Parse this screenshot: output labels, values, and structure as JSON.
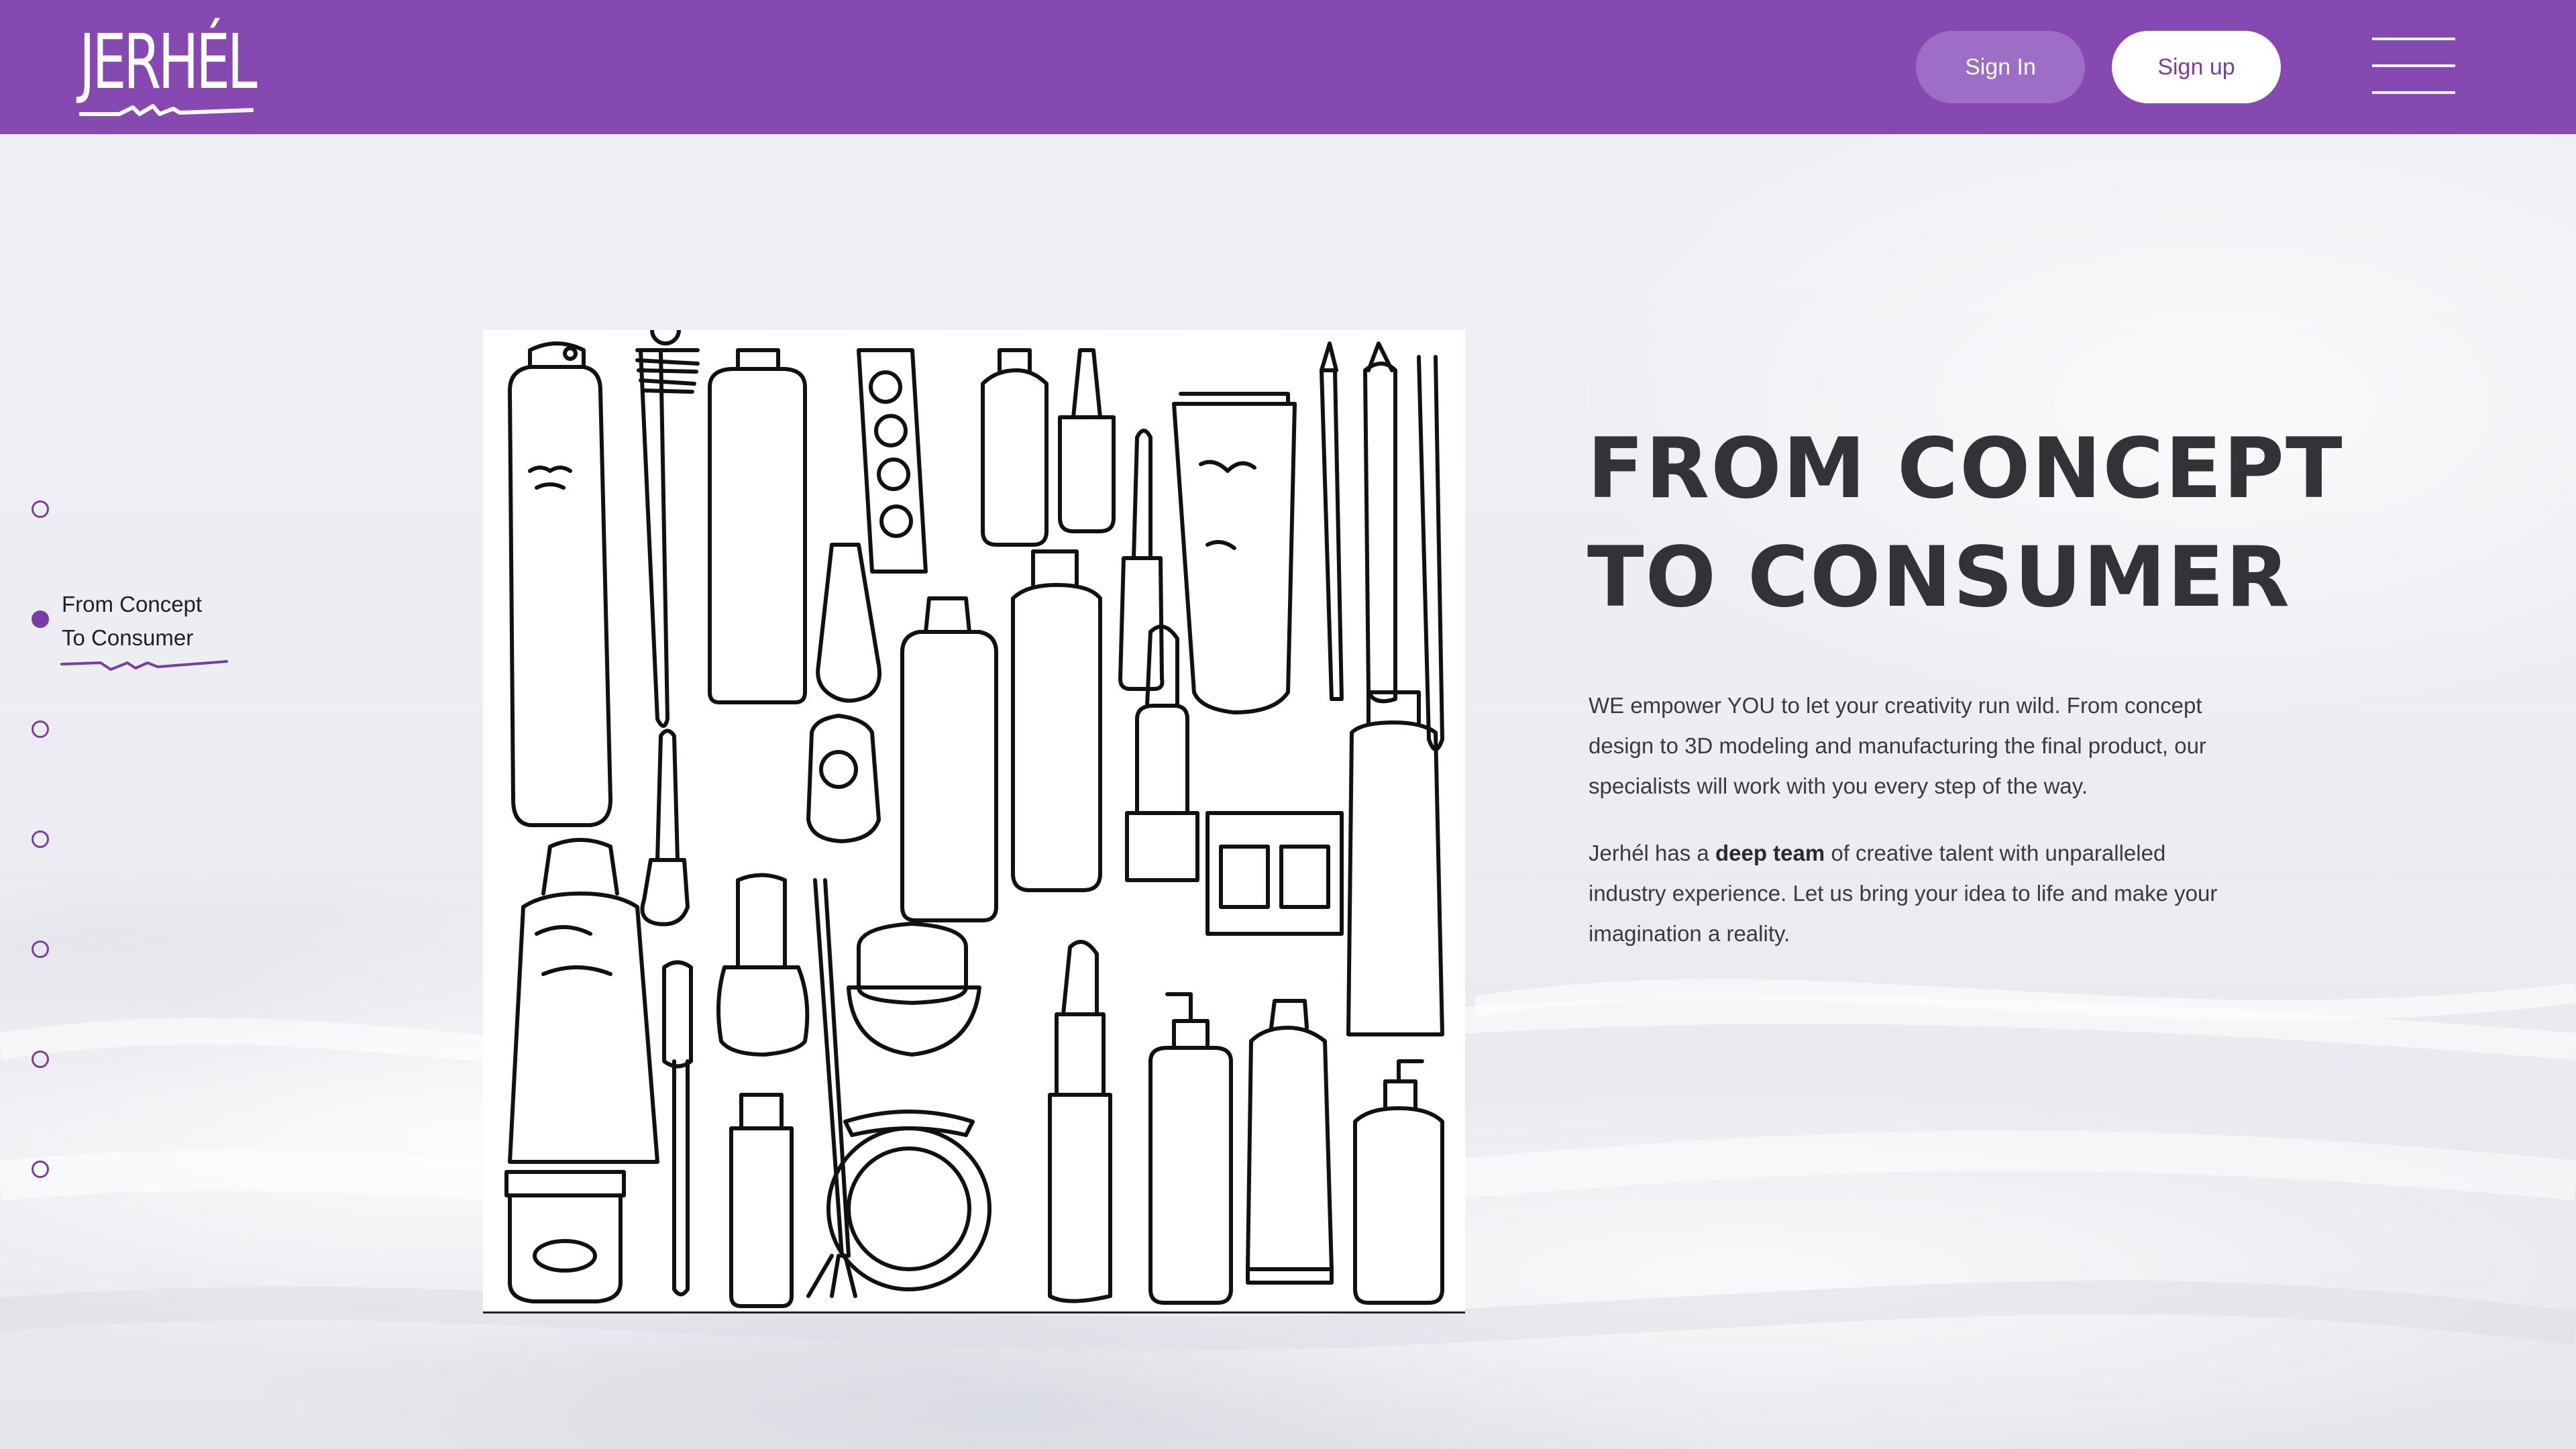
{
  "header": {
    "logo_text": "JERHÉL",
    "sign_in_label": "Sign In",
    "sign_up_label": "Sign up"
  },
  "section_nav": {
    "active_label_line1": "From Concept",
    "active_label_line2": "To Consumer",
    "dots_count": 7,
    "active_index": 1
  },
  "hero": {
    "headline_line1": "FROM CONCEPT",
    "headline_line2": "TO CONSUMER",
    "paragraph1": "WE empower YOU to let your creativity run wild. From concept design to 3D modeling and manufacturing the final product, our specialists will work with you every step of the way.",
    "paragraph2_pre": "Jerhél has a ",
    "paragraph2_bold": "deep team",
    "paragraph2_post": " of creative talent with unparalleled industry experience. Let us bring your idea to life and make your imagination a reality."
  },
  "colors": {
    "brand_purple": "#8549b1",
    "accent_purple": "#7a3da8",
    "background": "#eeeff3",
    "heading_text": "#333337"
  },
  "icons": {
    "menu": "hamburger-menu-icon",
    "nav_dot": "circle-icon"
  }
}
